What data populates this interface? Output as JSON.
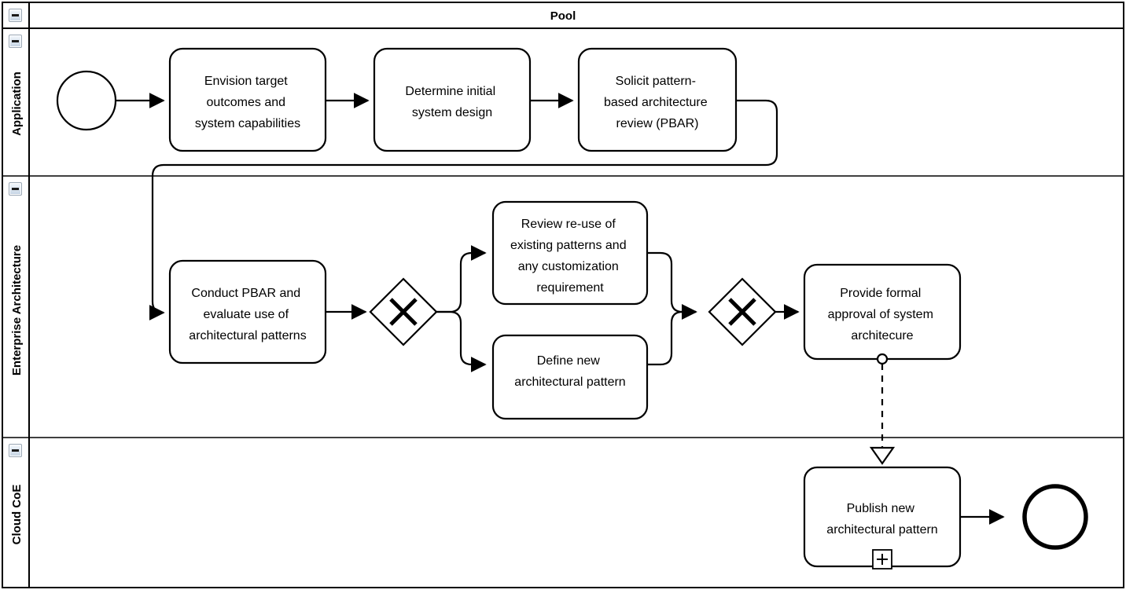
{
  "pool": {
    "title": "Pool",
    "collapse_icon": "minus-box-icon"
  },
  "lanes": [
    {
      "id": "application",
      "title": "Application",
      "collapse_icon": "minus-box-icon"
    },
    {
      "id": "enterprise-architecture",
      "title": "Enterprise Architecture",
      "collapse_icon": "minus-box-icon"
    },
    {
      "id": "cloud-coe",
      "title": "Cloud CoE",
      "collapse_icon": "minus-box-icon"
    }
  ],
  "events": {
    "start": {
      "type": "start-event",
      "label": ""
    },
    "end": {
      "type": "end-event",
      "label": ""
    }
  },
  "tasks": {
    "envision": {
      "lines": [
        "Envision target",
        "outcomes and",
        "system capabilities"
      ]
    },
    "determine": {
      "lines": [
        "Determine initial",
        "system design"
      ]
    },
    "solicit": {
      "lines": [
        "Solicit pattern-",
        "based architecture",
        "review (PBAR)"
      ]
    },
    "conduct": {
      "lines": [
        "Conduct PBAR and",
        "evaluate use of",
        "architectural patterns"
      ]
    },
    "review_reuse": {
      "lines": [
        "Review re-use of",
        "existing patterns and",
        "any customization",
        "requirement"
      ]
    },
    "define_new": {
      "lines": [
        "Define new",
        "architectural pattern"
      ]
    },
    "provide_approval": {
      "lines": [
        "Provide formal",
        "approval of system",
        "architecure"
      ]
    },
    "publish": {
      "lines": [
        "Publish new",
        "architectural pattern"
      ],
      "marker": "+"
    }
  },
  "gateways": {
    "split": {
      "type": "exclusive-gateway",
      "symbol": "X"
    },
    "join": {
      "type": "exclusive-gateway",
      "symbol": "X"
    }
  },
  "colors": {
    "stroke": "#000000",
    "fill": "#ffffff",
    "button_border": "#9aa7b5"
  }
}
